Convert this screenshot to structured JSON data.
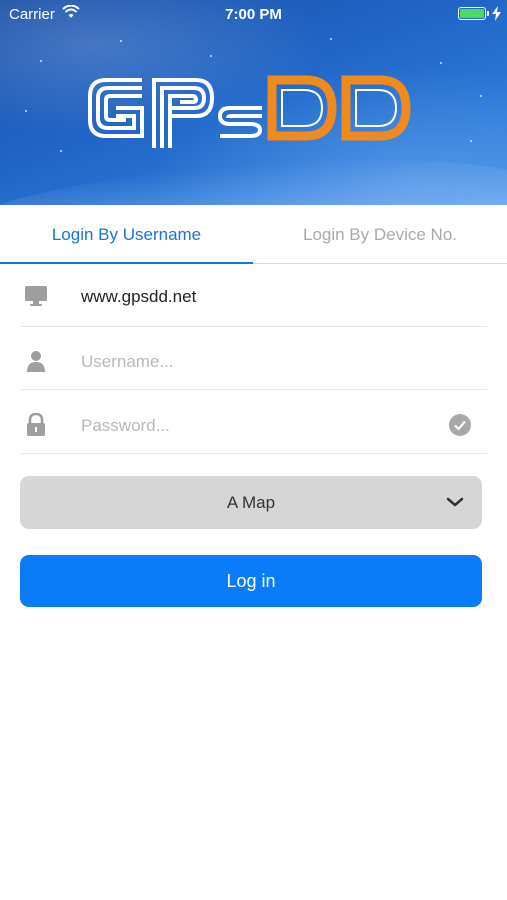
{
  "status_bar": {
    "carrier": "Carrier",
    "time": "7:00 PM",
    "battery_level": 1.0,
    "battery_color": "#4cd964",
    "wifi_icon": "wifi-icon"
  },
  "header": {
    "logo_text_left": "GPs",
    "logo_text_right": "DD",
    "logo_colors": {
      "left": "#ffffff",
      "right": "#f08a1c"
    }
  },
  "tabs": [
    {
      "label": "Login By Username",
      "active": true
    },
    {
      "label": "Login By Device No.",
      "active": false
    }
  ],
  "form": {
    "server": {
      "value": "www.gpsdd.net",
      "icon": "monitor-icon"
    },
    "username": {
      "value": "",
      "placeholder": "Username...",
      "icon": "user-icon"
    },
    "password": {
      "value": "",
      "placeholder": "Password...",
      "icon": "lock-icon",
      "remember_icon": "check-circle-icon"
    },
    "map_select": {
      "selected": "A Map",
      "icon": "chevron-down-icon"
    },
    "login_label": "Log in"
  },
  "colors": {
    "accent": "#1677d9",
    "login_button": "#0b7cf7",
    "select_bg": "#d6d6d6"
  }
}
